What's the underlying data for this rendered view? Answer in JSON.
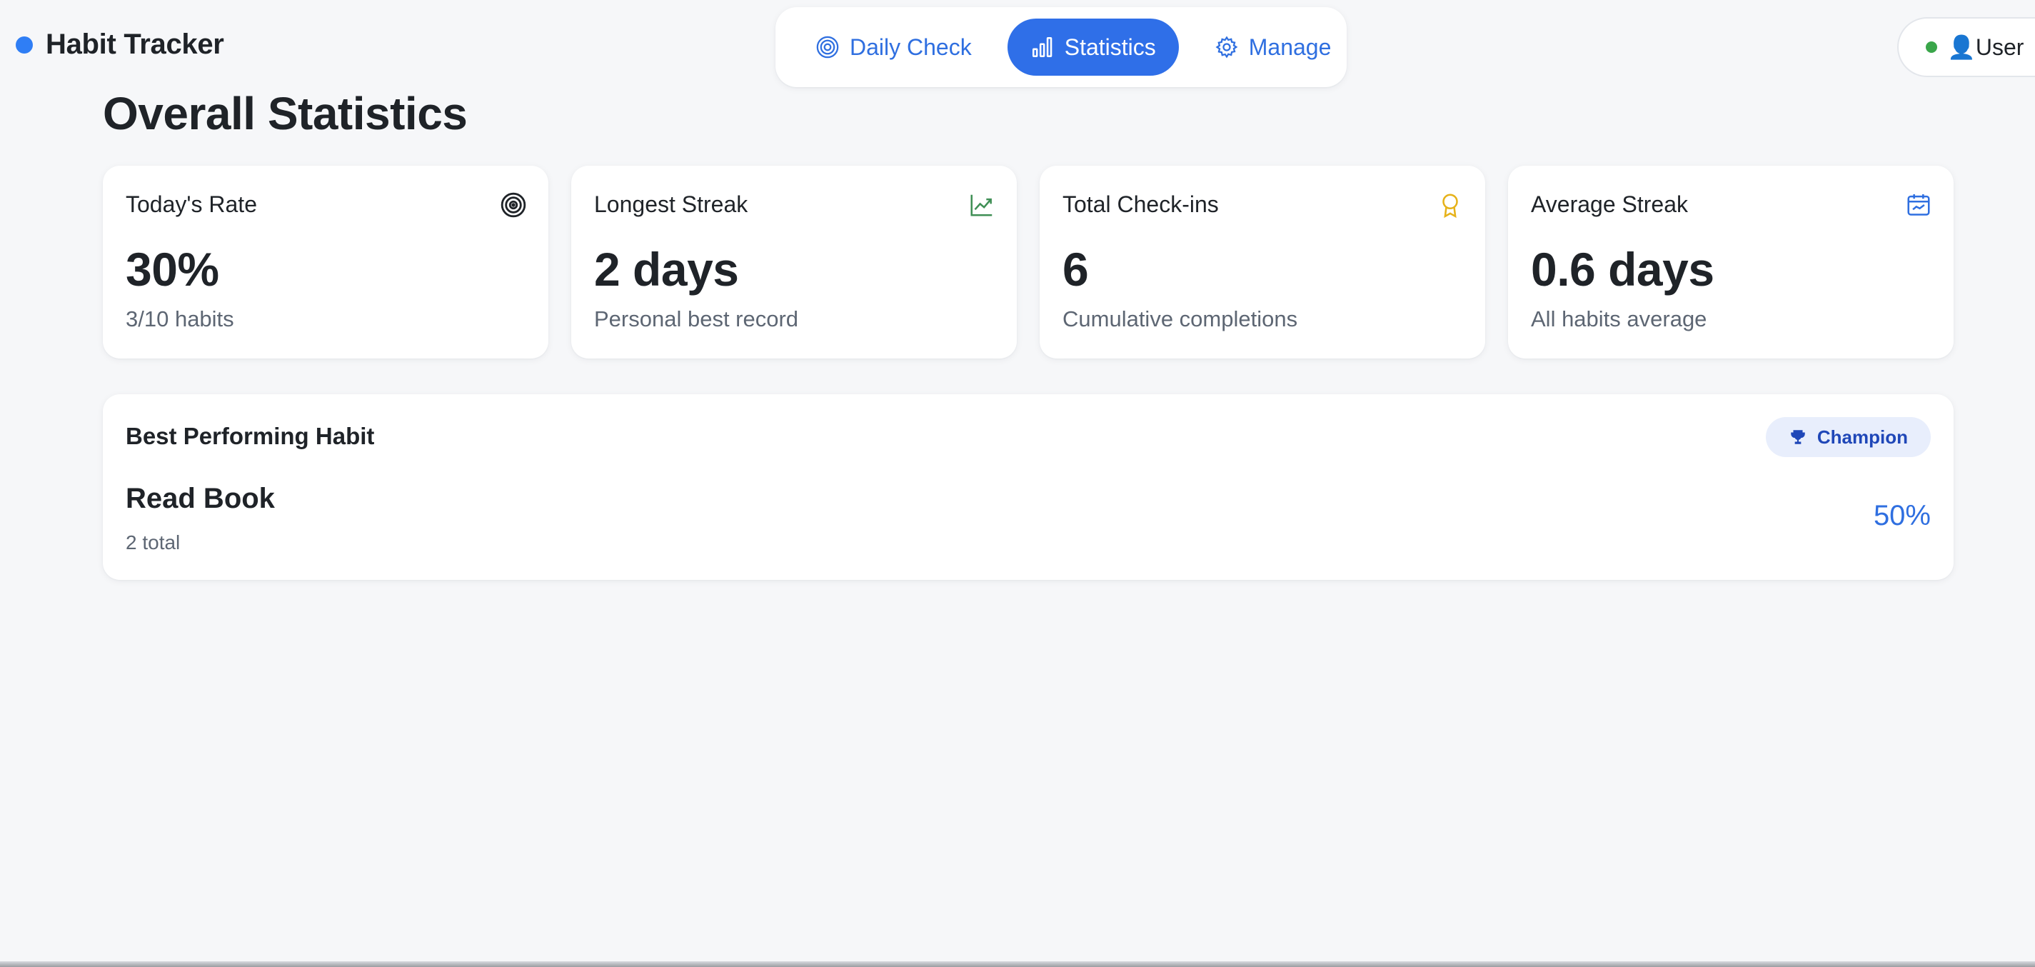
{
  "app": {
    "title": "Habit Tracker",
    "brand_color": "#2f7ef5"
  },
  "nav": {
    "tabs": [
      {
        "label": "Daily Check",
        "icon": "target-icon",
        "active": false
      },
      {
        "label": "Statistics",
        "icon": "bar-chart-icon",
        "active": true
      },
      {
        "label": "Manage",
        "icon": "gear-icon",
        "active": false
      }
    ]
  },
  "user": {
    "label": "👤User",
    "status": "online",
    "status_color": "#3aa64a"
  },
  "page": {
    "title": "Overall Statistics"
  },
  "stats": [
    {
      "label": "Today's Rate",
      "value": "30%",
      "sub": "3/10 habits",
      "icon": "target-icon",
      "icon_color": "#1f2328"
    },
    {
      "label": "Longest Streak",
      "value": "2 days",
      "sub": "Personal best record",
      "icon": "trending-up-icon",
      "icon_color": "#3f8f55"
    },
    {
      "label": "Total Check-ins",
      "value": "6",
      "sub": "Cumulative completions",
      "icon": "award-icon",
      "icon_color": "#e6b21a"
    },
    {
      "label": "Average Streak",
      "value": "0.6 days",
      "sub": "All habits average",
      "icon": "calendar-icon",
      "icon_color": "#2f6fe0"
    }
  ],
  "best_habit": {
    "title": "Best Performing Habit",
    "badge": "Champion",
    "badge_icon": "trophy-icon",
    "name": "Read Book",
    "sub": "2 total",
    "rate": "50%"
  }
}
